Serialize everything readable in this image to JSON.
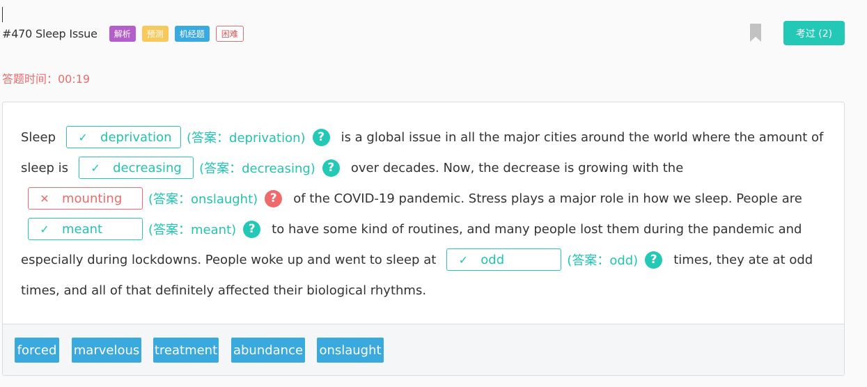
{
  "header": {
    "title": "#470 Sleep Issue",
    "tags": [
      "解析",
      "预测",
      "机经题",
      "困难"
    ],
    "exam_button": "考过 (2)"
  },
  "timer": "答题时间：00:19",
  "passage": {
    "t1": "Sleep",
    "b1": {
      "mark": "✓",
      "value": "deprivation",
      "answer": "(答案：deprivation)",
      "correct": true
    },
    "t2": "is a global issue in all the major cities around the world where the amount of",
    "t3": "sleep is",
    "b2": {
      "mark": "✓",
      "value": "decreasing",
      "answer": "(答案：decreasing)",
      "correct": true
    },
    "t4": "over decades. Now, the decrease is growing with the",
    "b3": {
      "mark": "✕",
      "value": "mounting",
      "answer": "(答案：onslaught)",
      "correct": false
    },
    "t5": "of the COVID-19 pandemic. Stress plays a major role in how we sleep. People are",
    "b4": {
      "mark": "✓",
      "value": "meant",
      "answer": "(答案：meant)",
      "correct": true
    },
    "t6": "to have some kind of routines, and many people lost them during the pandemic and",
    "t7": "especially during lockdowns. People woke up and went to sleep at",
    "b5": {
      "mark": "✓",
      "value": "odd",
      "answer": "(答案：odd)",
      "correct": true
    },
    "t8": "times, they ate at odd",
    "t9": "times, and all of that definitely affected their biological rhythms.",
    "help_glyph": "?"
  },
  "options": [
    "forced",
    "marvelous",
    "treatment",
    "abundance",
    "onslaught"
  ],
  "colors": {
    "accent": "#23c9b6",
    "wrong": "#ef6b6b",
    "option": "#3aa9de"
  }
}
